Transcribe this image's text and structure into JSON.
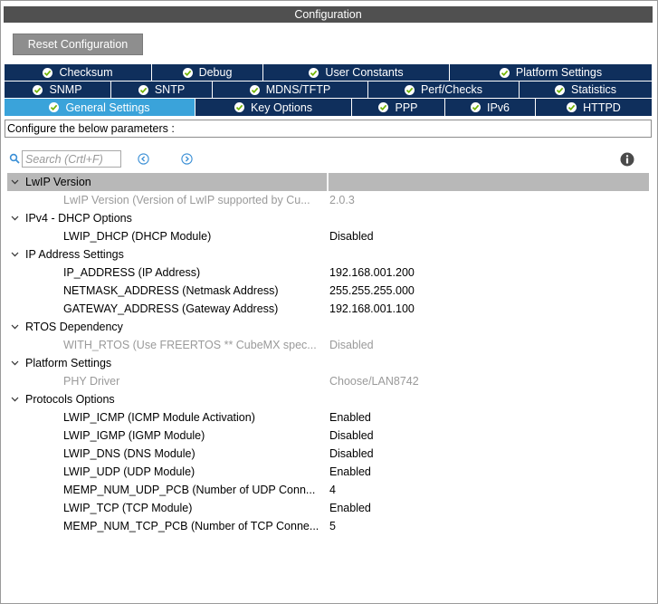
{
  "window": {
    "title": "Configuration"
  },
  "reset_button": "Reset Configuration",
  "tabs": {
    "row1": [
      {
        "label": "Checksum",
        "w": 163
      },
      {
        "label": "Debug",
        "w": 123
      },
      {
        "label": "User Constants",
        "w": 206
      },
      {
        "label": "Platform Settings",
        "w": 224
      }
    ],
    "row2": [
      {
        "label": "SNMP",
        "w": 118
      },
      {
        "label": "SNTP",
        "w": 112
      },
      {
        "label": "MDNS/TFTP",
        "w": 172
      },
      {
        "label": "Perf/Checks",
        "w": 167
      },
      {
        "label": "Statistics",
        "w": 147
      }
    ],
    "row3": [
      {
        "label": "General Settings",
        "w": 211,
        "active": true
      },
      {
        "label": "Key Options",
        "w": 173
      },
      {
        "label": "PPP",
        "w": 103
      },
      {
        "label": "IPv6",
        "w": 100
      },
      {
        "label": "HTTPD",
        "w": 129
      }
    ]
  },
  "configure_text": "Configure the below parameters :",
  "search": {
    "placeholder": "Search (Crtl+F)"
  },
  "icons": {
    "search": "search-icon",
    "prev": "chevron-left-circle-icon",
    "next": "chevron-right-circle-icon",
    "info": "info-icon",
    "check": "check-circle-icon",
    "caret": "caret-down-icon"
  },
  "colors": {
    "tab_bg": "#0f2f5c",
    "tab_active": "#3aa3da",
    "header_gray": "#b8b8b8",
    "title_bar": "#505050"
  },
  "groups": [
    {
      "label": "LwIP Version",
      "header": true,
      "params": [
        {
          "name": "LwIP Version (Version of LwIP supported by Cu...",
          "value": "2.0.3",
          "disabled": true
        }
      ]
    },
    {
      "label": "IPv4 - DHCP Options",
      "params": [
        {
          "name": "LWIP_DHCP (DHCP Module)",
          "value": "Disabled"
        }
      ]
    },
    {
      "label": "IP Address Settings",
      "params": [
        {
          "name": "IP_ADDRESS (IP Address)",
          "value": "192.168.001.200"
        },
        {
          "name": "NETMASK_ADDRESS (Netmask Address)",
          "value": "255.255.255.000"
        },
        {
          "name": "GATEWAY_ADDRESS (Gateway Address)",
          "value": "192.168.001.100"
        }
      ]
    },
    {
      "label": "RTOS Dependency",
      "params": [
        {
          "name": "WITH_RTOS (Use FREERTOS ** CubeMX spec...",
          "value": "Disabled",
          "disabled": true
        }
      ]
    },
    {
      "label": "Platform Settings",
      "params": [
        {
          "name": "PHY Driver",
          "value": "Choose/LAN8742",
          "disabled": true
        }
      ]
    },
    {
      "label": "Protocols Options",
      "params": [
        {
          "name": "LWIP_ICMP (ICMP Module Activation)",
          "value": "Enabled"
        },
        {
          "name": "LWIP_IGMP (IGMP Module)",
          "value": "Disabled"
        },
        {
          "name": "LWIP_DNS (DNS Module)",
          "value": "Disabled"
        },
        {
          "name": "LWIP_UDP (UDP Module)",
          "value": "Enabled"
        },
        {
          "name": "MEMP_NUM_UDP_PCB (Number of UDP Conn...",
          "value": "4"
        },
        {
          "name": "LWIP_TCP (TCP Module)",
          "value": "Enabled"
        },
        {
          "name": "MEMP_NUM_TCP_PCB (Number of TCP Conne...",
          "value": "5"
        }
      ]
    }
  ]
}
